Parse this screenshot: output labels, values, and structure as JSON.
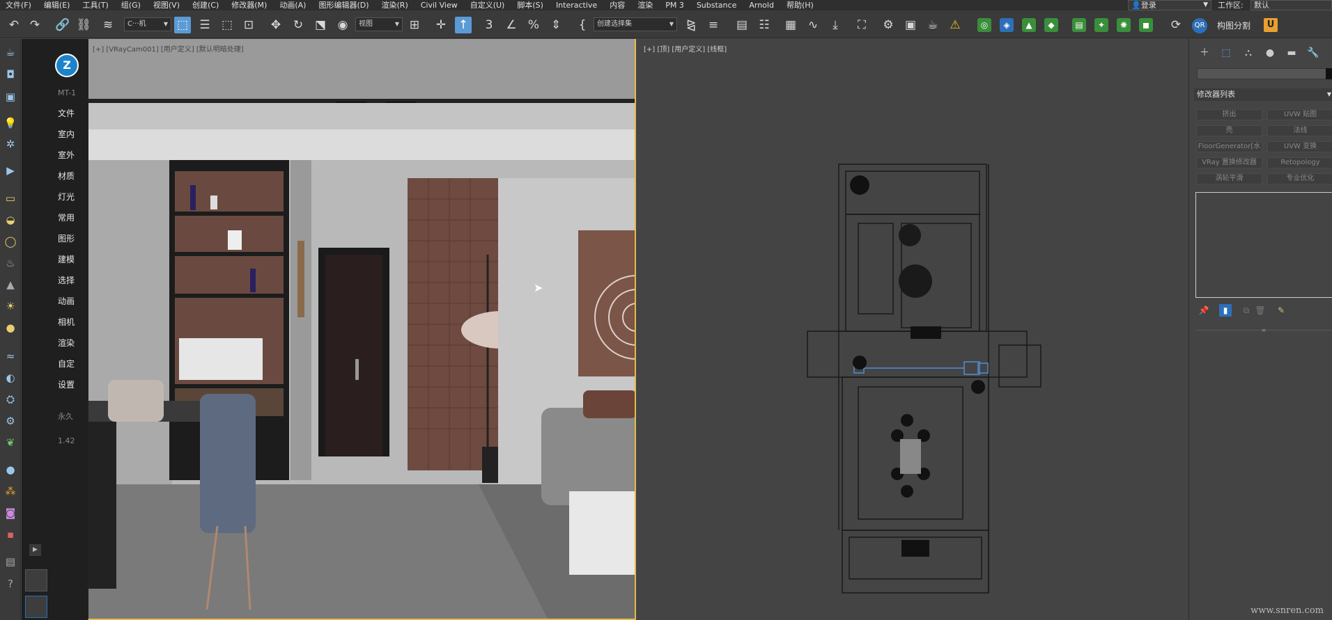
{
  "menu": [
    "文件(F)",
    "编辑(E)",
    "工具(T)",
    "组(G)",
    "视图(V)",
    "创建(C)",
    "修改器(M)",
    "动画(A)",
    "图形编辑器(D)",
    "渲染(R)",
    "Civil View",
    "自定义(U)",
    "脚本(S)",
    "Interactive",
    "内容",
    "渲染",
    "PM 3",
    "Substance",
    "Arnold",
    "帮助(H)"
  ],
  "login": "登录",
  "workspace": {
    "label": "工作区:",
    "value": "默认"
  },
  "toolbar": {
    "filter": "C···机",
    "refcoord": "视图",
    "selset": "创建选择集",
    "split_label": "构图分割",
    "qr": "QR",
    "u": "U"
  },
  "plugin": {
    "logo": "Z",
    "version": "MT-1",
    "items": [
      "文件",
      "室内",
      "室外",
      "材质",
      "灯光",
      "常用",
      "图形",
      "建模",
      "选择",
      "动画",
      "相机",
      "渲染",
      "自定",
      "设置"
    ],
    "perm": "永久",
    "ver_num": "1.42"
  },
  "viewport_left": {
    "label": "[+] [VRayCam001] [用户定义] [默认明暗处理]"
  },
  "viewport_right": {
    "label": "[+] [顶] [用户定义] [线框]"
  },
  "command_panel": {
    "modifier_list": "修改器列表",
    "buttons": [
      "挤出",
      "UVW 贴图",
      "壳",
      "法线",
      "FloorGenerator[水",
      "UVW 变换",
      "VRay 置换修改器",
      "Retopology",
      "涡轮平滑",
      "专业优化"
    ]
  },
  "watermark": "www.snren.com",
  "colors": {
    "active_border": "#e8b84b",
    "accent": "#5b9bd5"
  }
}
